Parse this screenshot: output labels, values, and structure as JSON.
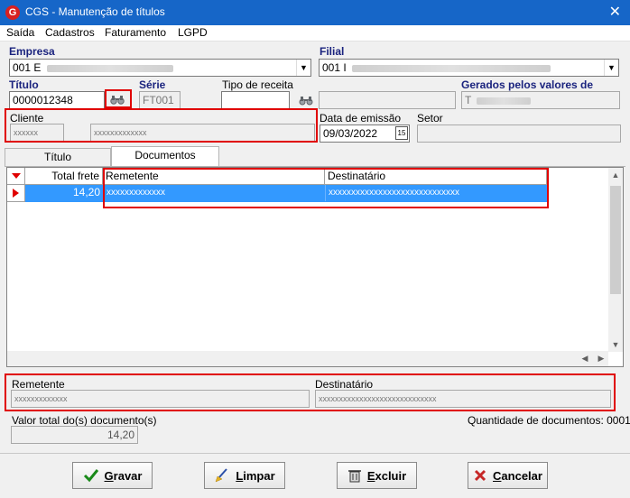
{
  "window": {
    "title": "CGS - Manutenção de títulos",
    "close_glyph": "✕"
  },
  "menu": [
    "Saída",
    "Cadastros",
    "Faturamento",
    "LGPD"
  ],
  "header": {
    "empresa_label": "Empresa",
    "empresa_value": "001 E",
    "filial_label": "Filial",
    "filial_value": "001 I",
    "titulo_label": "Título",
    "titulo_value": "0000012348",
    "serie_label": "Série",
    "serie_value": "FT001",
    "tipo_receita_label": "Tipo de receita",
    "gerados_label": "Gerados pelos valores de",
    "gerados_value": "T",
    "cliente_label": "Cliente",
    "cliente_code": "xxxxxx",
    "cliente_name": "xxxxxxxxxxxxx",
    "data_emissao_label": "Data de emissão",
    "data_emissao_value": "09/03/2022",
    "setor_label": "Setor"
  },
  "tabs": [
    {
      "label": "Título"
    },
    {
      "label": "Documentos"
    }
  ],
  "grid": {
    "columns": [
      "Total frete",
      "Remetente",
      "Destinatário"
    ],
    "rows": [
      {
        "total_frete": "14,20",
        "remetente": "xxxxxxxxxxxxx",
        "destinatario": "xxxxxxxxxxxxxxxxxxxxxxxxxxxxx"
      }
    ]
  },
  "detail": {
    "remetente_label": "Remetente",
    "remetente_value": "xxxxxxxxxxxxx",
    "destinatario_label": "Destinatário",
    "destinatario_value": "xxxxxxxxxxxxxxxxxxxxxxxxxxxxx"
  },
  "footer": {
    "valor_total_label": "Valor total do(s) documento(s)",
    "valor_total_value": "14,20",
    "quantidade_label": "Quantidade de documentos: 0001"
  },
  "buttons": {
    "gravar_rest": "ravar",
    "gravar_key": "G",
    "limpar_rest": "impar",
    "limpar_key": "L",
    "excluir_rest": "xcluir",
    "excluir_key": "E",
    "cancelar_rest": "ancelar",
    "cancelar_key": "C"
  },
  "colors": {
    "titlebar": "#1666c8",
    "selection": "#3399ff",
    "highlight": "#e00000",
    "label_bold": "#1a237e"
  }
}
